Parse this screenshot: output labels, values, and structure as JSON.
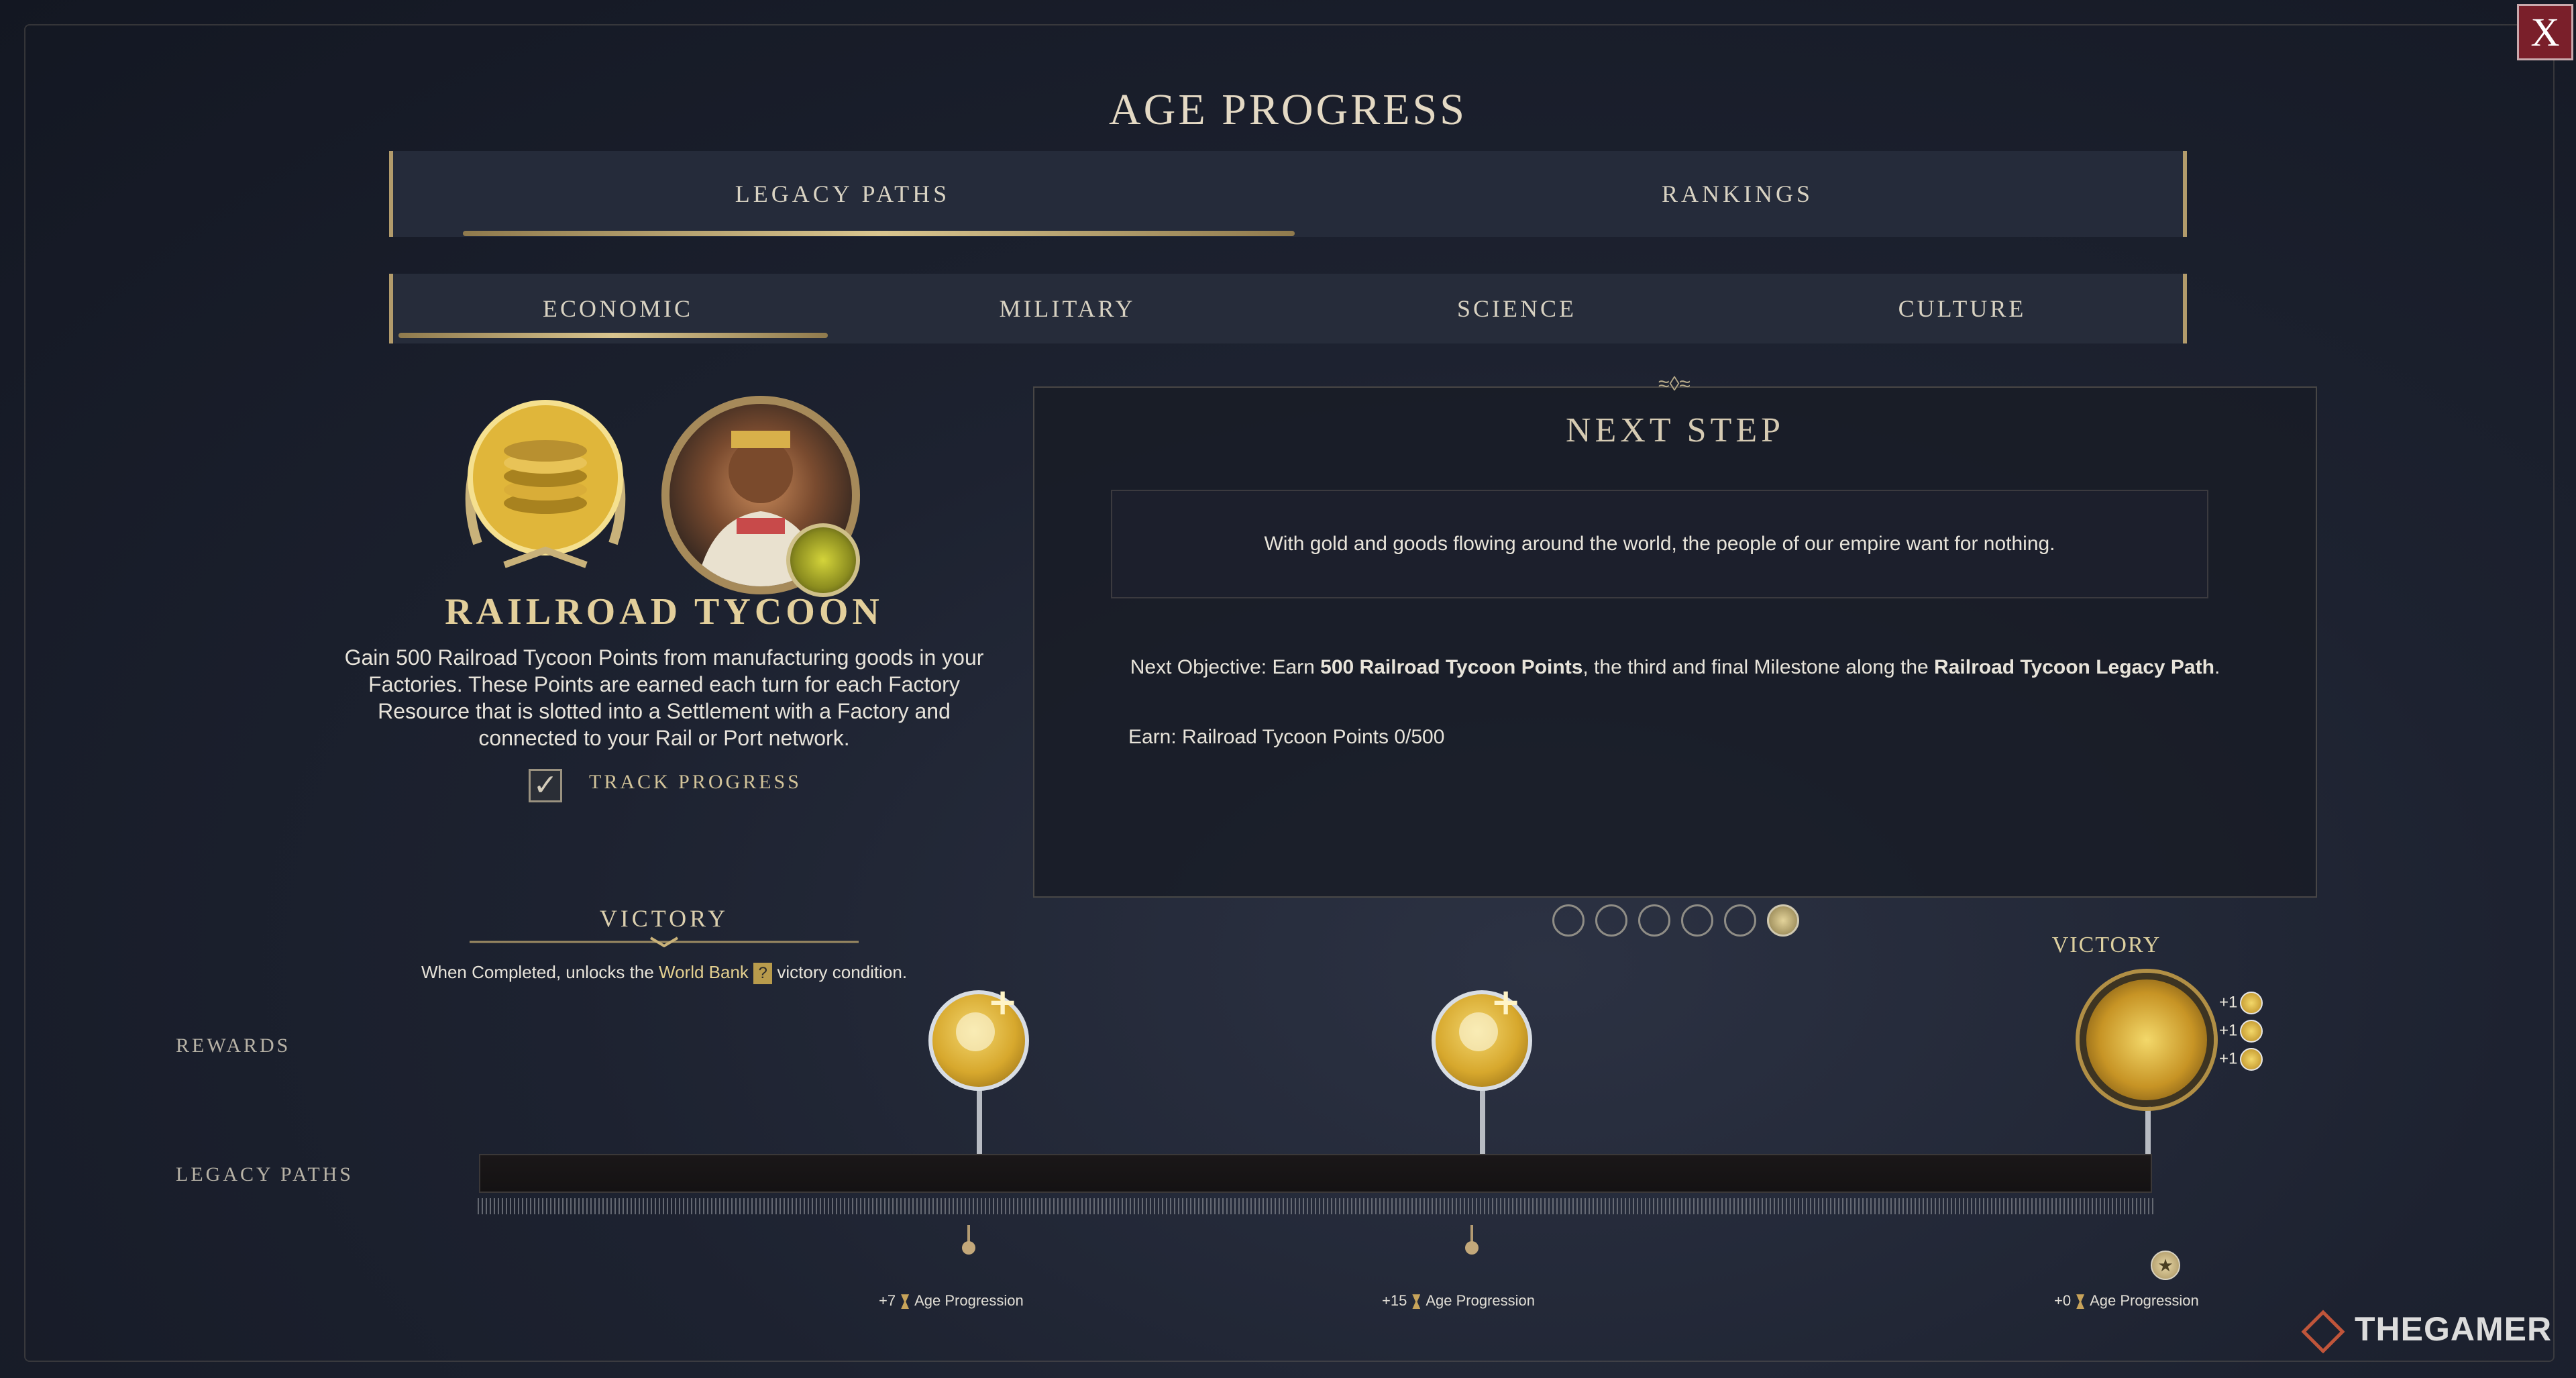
{
  "window": {
    "title": "AGE PROGRESS",
    "close_label": "X"
  },
  "tabs": [
    {
      "label": "LEGACY PATHS",
      "active": true
    },
    {
      "label": "RANKINGS",
      "active": false
    }
  ],
  "subtabs": [
    {
      "label": "ECONOMIC",
      "active": true
    },
    {
      "label": "MILITARY",
      "active": false
    },
    {
      "label": "SCIENCE",
      "active": false
    },
    {
      "label": "CULTURE",
      "active": false
    }
  ],
  "path": {
    "name": "RAILROAD TYCOON",
    "description_lines": [
      "Gain 500 Railroad Tycoon Points from manufacturing goods in your",
      "Factories. These Points are earned each turn for each Factory",
      "Resource that is slotted into a Settlement with a Factory and",
      "connected to your Rail or Port network."
    ],
    "track_label": "TRACK PROGRESS",
    "tracked": true,
    "victory_heading": "VICTORY",
    "victory_text_before": "When Completed, unlocks the ",
    "victory_link": "World Bank",
    "victory_help_icon": "?",
    "victory_text_after": " victory condition."
  },
  "next_step": {
    "title": "NEXT STEP",
    "quote": "With gold and goods flowing around the world, the people of our empire want for nothing.",
    "objective_prefix": "Next Objective: Earn ",
    "objective_bold1": "500 Railroad Tycoon Points",
    "objective_mid": ", the third and final Milestone along the ",
    "objective_bold2": "Railroad Tycoon Legacy Path",
    "objective_suffix": ".",
    "earn_text": "Earn: Railroad Tycoon Points 0/500",
    "pages_total": 6,
    "page_active": 6
  },
  "timeline": {
    "rewards_label": "REWARDS",
    "paths_label": "LEGACY PATHS",
    "progress": 0.0,
    "victory_label": "VICTORY",
    "victory_bonuses": [
      "+1",
      "+1",
      "+1"
    ],
    "milestones": [
      {
        "age_prefix": "+7",
        "age_label": "Age Progression",
        "reward_icon": "great-person-plus-icon"
      },
      {
        "age_prefix": "+15",
        "age_label": "Age Progression",
        "reward_icon": "great-person-plus-icon"
      },
      {
        "age_prefix": "+0",
        "age_label": "Age Progression",
        "reward_icon": "gold-coins-medal-icon"
      }
    ]
  },
  "watermark": "THEGAMER",
  "colors": {
    "accent_gold": "#d9c58f",
    "close_red": "#7a1f2a",
    "reward_gold": "#d7a82d"
  }
}
